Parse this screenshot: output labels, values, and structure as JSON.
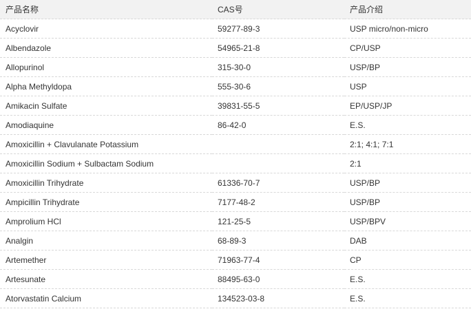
{
  "headers": {
    "name": "产品名称",
    "cas": "CAS号",
    "desc": "产品介绍"
  },
  "rows": [
    {
      "name": "Acyclovir",
      "cas": "59277-89-3",
      "desc": "USP micro/non-micro"
    },
    {
      "name": "Albendazole",
      "cas": "54965-21-8",
      "desc": "CP/USP"
    },
    {
      "name": "Allopurinol",
      "cas": "315-30-0",
      "desc": "USP/BP"
    },
    {
      "name": "Alpha Methyldopa",
      "cas": "555-30-6",
      "desc": "USP"
    },
    {
      "name": "Amikacin Sulfate",
      "cas": "39831-55-5",
      "desc": "EP/USP/JP"
    },
    {
      "name": "Amodiaquine",
      "cas": "86-42-0",
      "desc": "E.S."
    },
    {
      "name": "Amoxicillin + Clavulanate Potassium",
      "cas": "",
      "desc": "2:1; 4:1; 7:1"
    },
    {
      "name": "Amoxicillin Sodium + Sulbactam Sodium",
      "cas": "",
      "desc": "2:1"
    },
    {
      "name": "Amoxicillin Trihydrate",
      "cas": "61336-70-7",
      "desc": "USP/BP"
    },
    {
      "name": "Ampicillin Trihydrate",
      "cas": "7177-48-2",
      "desc": "USP/BP"
    },
    {
      "name": "Amprolium HCl",
      "cas": "121-25-5",
      "desc": "USP/BPV"
    },
    {
      "name": "Analgin",
      "cas": "68-89-3",
      "desc": "DAB"
    },
    {
      "name": "Artemether",
      "cas": "71963-77-4",
      "desc": "CP"
    },
    {
      "name": "Artesunate",
      "cas": "88495-63-0",
      "desc": "E.S."
    },
    {
      "name": "Atorvastatin Calcium",
      "cas": "134523-03-8",
      "desc": "E.S."
    }
  ]
}
